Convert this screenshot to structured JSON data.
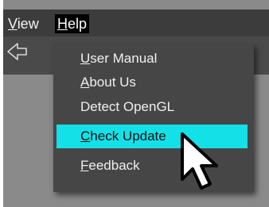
{
  "menubar": {
    "items": [
      {
        "label": "View",
        "accelerator": "V",
        "rest": "iew"
      },
      {
        "label": "Help",
        "accelerator": "H",
        "rest": "elp",
        "active": true
      }
    ]
  },
  "toolbar": {
    "back_icon": "back-arrow-icon"
  },
  "help_menu": {
    "items": [
      {
        "label": "User Manual",
        "accelerator": "U",
        "rest": "ser Manual"
      },
      {
        "label": "About Us",
        "accelerator": "A",
        "rest": "bout Us"
      },
      {
        "label": "Detect OpenGL",
        "accelerator": "",
        "rest": "Detect OpenGL"
      },
      {
        "label": "Check Update",
        "accelerator": "C",
        "rest": "heck Update",
        "highlighted": true
      },
      {
        "label": "Feedback",
        "accelerator": "F",
        "rest": "eedback"
      }
    ]
  },
  "colors": {
    "menubar_bg": "#3c3c3c",
    "menu_bg": "#464646",
    "highlight": "#14e0e8",
    "content_bg": "#8a8a8a"
  },
  "cursor": {
    "icon": "mouse-pointer-icon"
  }
}
